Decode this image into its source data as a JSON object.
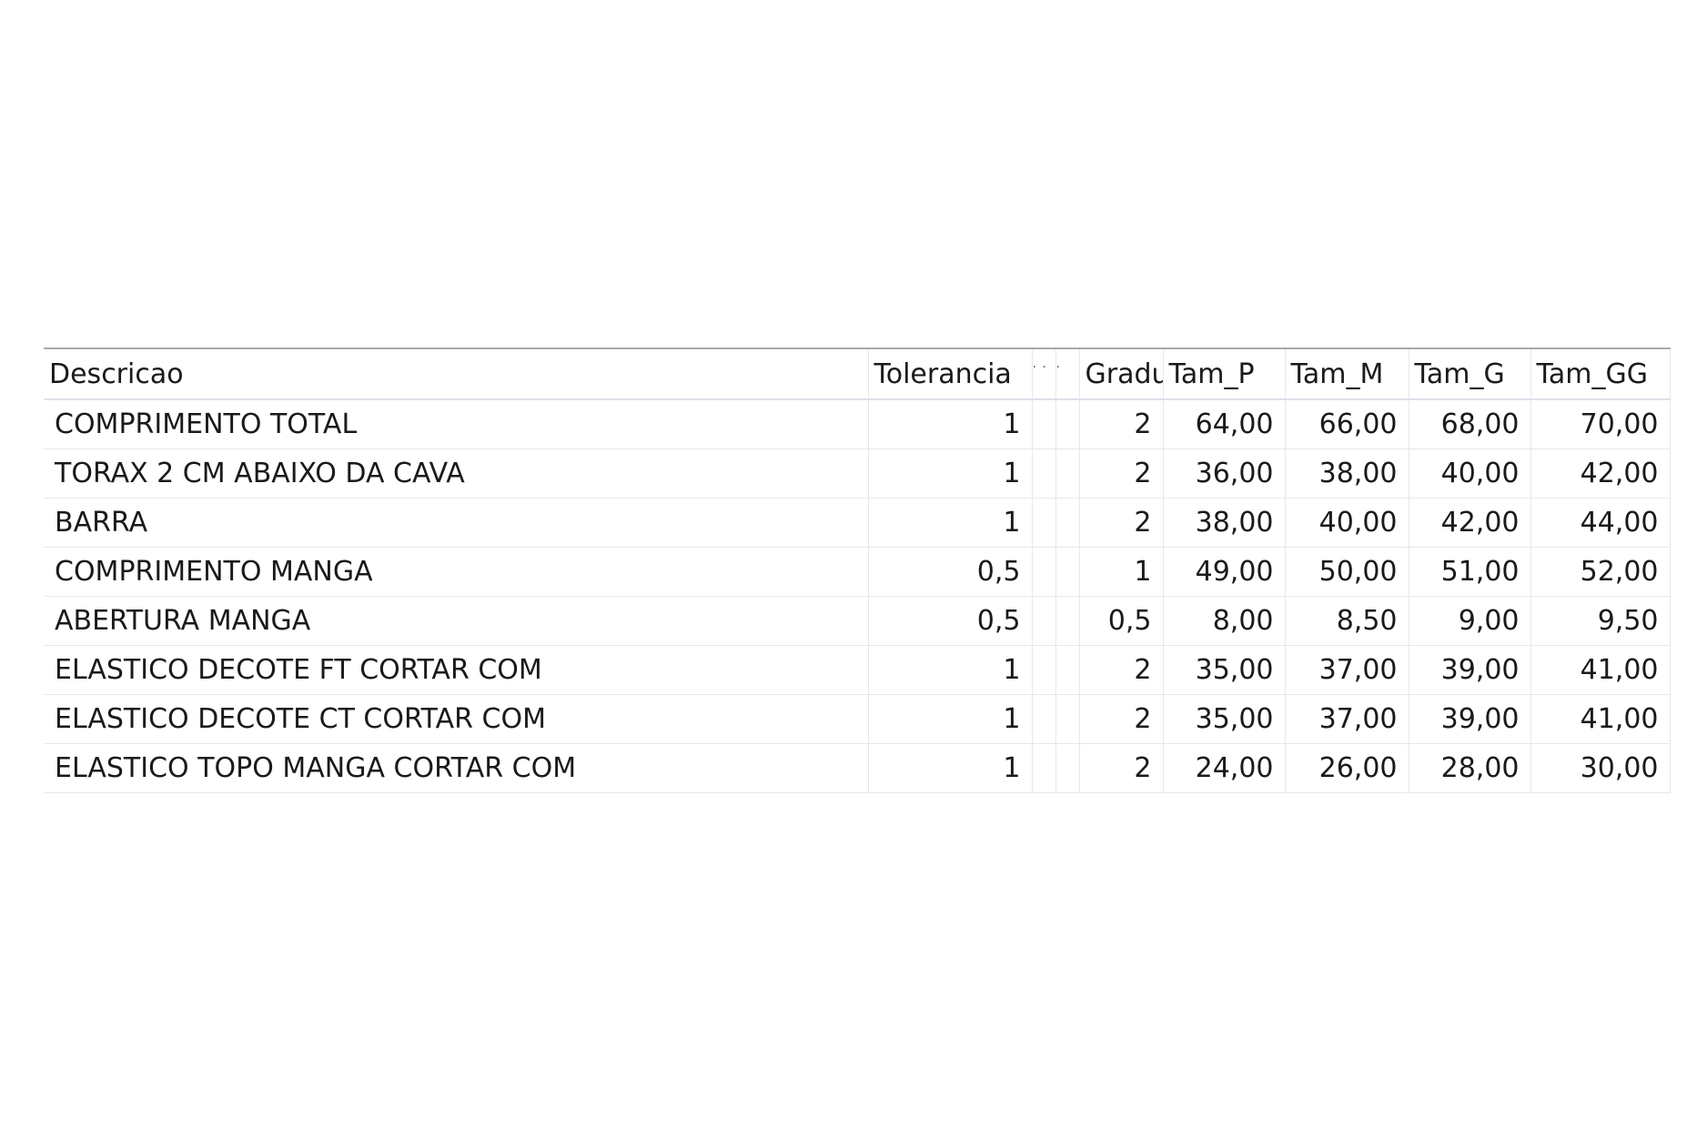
{
  "table": {
    "headers": {
      "descricao": "Descricao",
      "tolerancia": "Tolerancia",
      "hidden_a": "· ·",
      "hidden_b": "·",
      "gradu": "Gradu",
      "tam_p": "Tam_P",
      "tam_m": "Tam_M",
      "tam_g": "Tam_G",
      "tam_gg": "Tam_GG"
    },
    "rows": [
      {
        "descricao": "COMPRIMENTO TOTAL",
        "tolerancia": "1",
        "gradu": "2",
        "tam_p": "64,00",
        "tam_m": "66,00",
        "tam_g": "68,00",
        "tam_gg": "70,00"
      },
      {
        "descricao": "TORAX 2 CM ABAIXO DA CAVA",
        "tolerancia": "1",
        "gradu": "2",
        "tam_p": "36,00",
        "tam_m": "38,00",
        "tam_g": "40,00",
        "tam_gg": "42,00"
      },
      {
        "descricao": "BARRA",
        "tolerancia": "1",
        "gradu": "2",
        "tam_p": "38,00",
        "tam_m": "40,00",
        "tam_g": "42,00",
        "tam_gg": "44,00"
      },
      {
        "descricao": "COMPRIMENTO MANGA",
        "tolerancia": "0,5",
        "gradu": "1",
        "tam_p": "49,00",
        "tam_m": "50,00",
        "tam_g": "51,00",
        "tam_gg": "52,00"
      },
      {
        "descricao": "ABERTURA MANGA",
        "tolerancia": "0,5",
        "gradu": "0,5",
        "tam_p": "8,00",
        "tam_m": "8,50",
        "tam_g": "9,00",
        "tam_gg": "9,50"
      },
      {
        "descricao": "ELASTICO DECOTE FT CORTAR COM",
        "tolerancia": "1",
        "gradu": "2",
        "tam_p": "35,00",
        "tam_m": "37,00",
        "tam_g": "39,00",
        "tam_gg": "41,00"
      },
      {
        "descricao": "ELASTICO DECOTE CT CORTAR COM",
        "tolerancia": "1",
        "gradu": "2",
        "tam_p": "35,00",
        "tam_m": "37,00",
        "tam_g": "39,00",
        "tam_gg": "41,00"
      },
      {
        "descricao": "ELASTICO TOPO MANGA CORTAR COM",
        "tolerancia": "1",
        "gradu": "2",
        "tam_p": "24,00",
        "tam_m": "26,00",
        "tam_g": "28,00",
        "tam_gg": "30,00"
      }
    ]
  },
  "colors": {
    "header_border": "#a9a9a9",
    "grid_line": "#e4e8ee",
    "text": "#1a1a1a"
  }
}
